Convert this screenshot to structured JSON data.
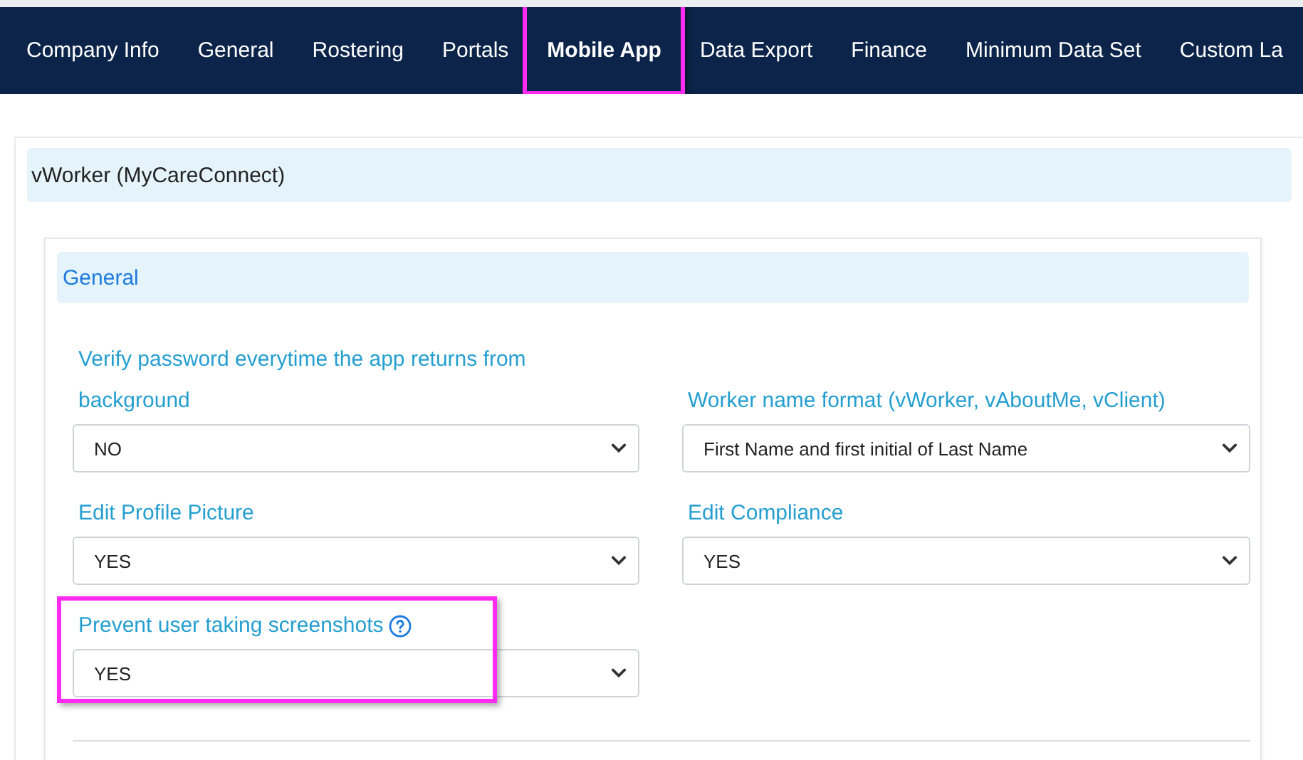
{
  "tabs": [
    {
      "label": "Company Info",
      "selected": false,
      "highlighted": false
    },
    {
      "label": "General",
      "selected": false,
      "highlighted": false
    },
    {
      "label": "Rostering",
      "selected": false,
      "highlighted": false
    },
    {
      "label": "Portals",
      "selected": false,
      "highlighted": false
    },
    {
      "label": "Mobile App",
      "selected": true,
      "highlighted": true
    },
    {
      "label": "Data Export",
      "selected": false,
      "highlighted": false
    },
    {
      "label": "Finance",
      "selected": false,
      "highlighted": false
    },
    {
      "label": "Minimum Data Set",
      "selected": false,
      "highlighted": false
    },
    {
      "label": "Custom La",
      "selected": false,
      "highlighted": false
    }
  ],
  "panel": {
    "title": "vWorker (MyCareConnect)",
    "section": {
      "title": "General",
      "fields": [
        {
          "label": "Verify password everytime the app returns from background",
          "value": "NO",
          "help": false,
          "highlighted": false
        },
        {
          "label": "Worker name format (vWorker, vAboutMe, vClient)",
          "value": "First Name and first initial of Last Name",
          "help": false,
          "highlighted": false
        },
        {
          "label": "Edit Profile Picture",
          "value": "YES",
          "help": false,
          "highlighted": false
        },
        {
          "label": "Edit Compliance",
          "value": "YES",
          "help": false,
          "highlighted": false
        },
        {
          "label": "Prevent user taking screenshots",
          "value": "YES",
          "help": true,
          "highlighted": true
        }
      ]
    }
  }
}
